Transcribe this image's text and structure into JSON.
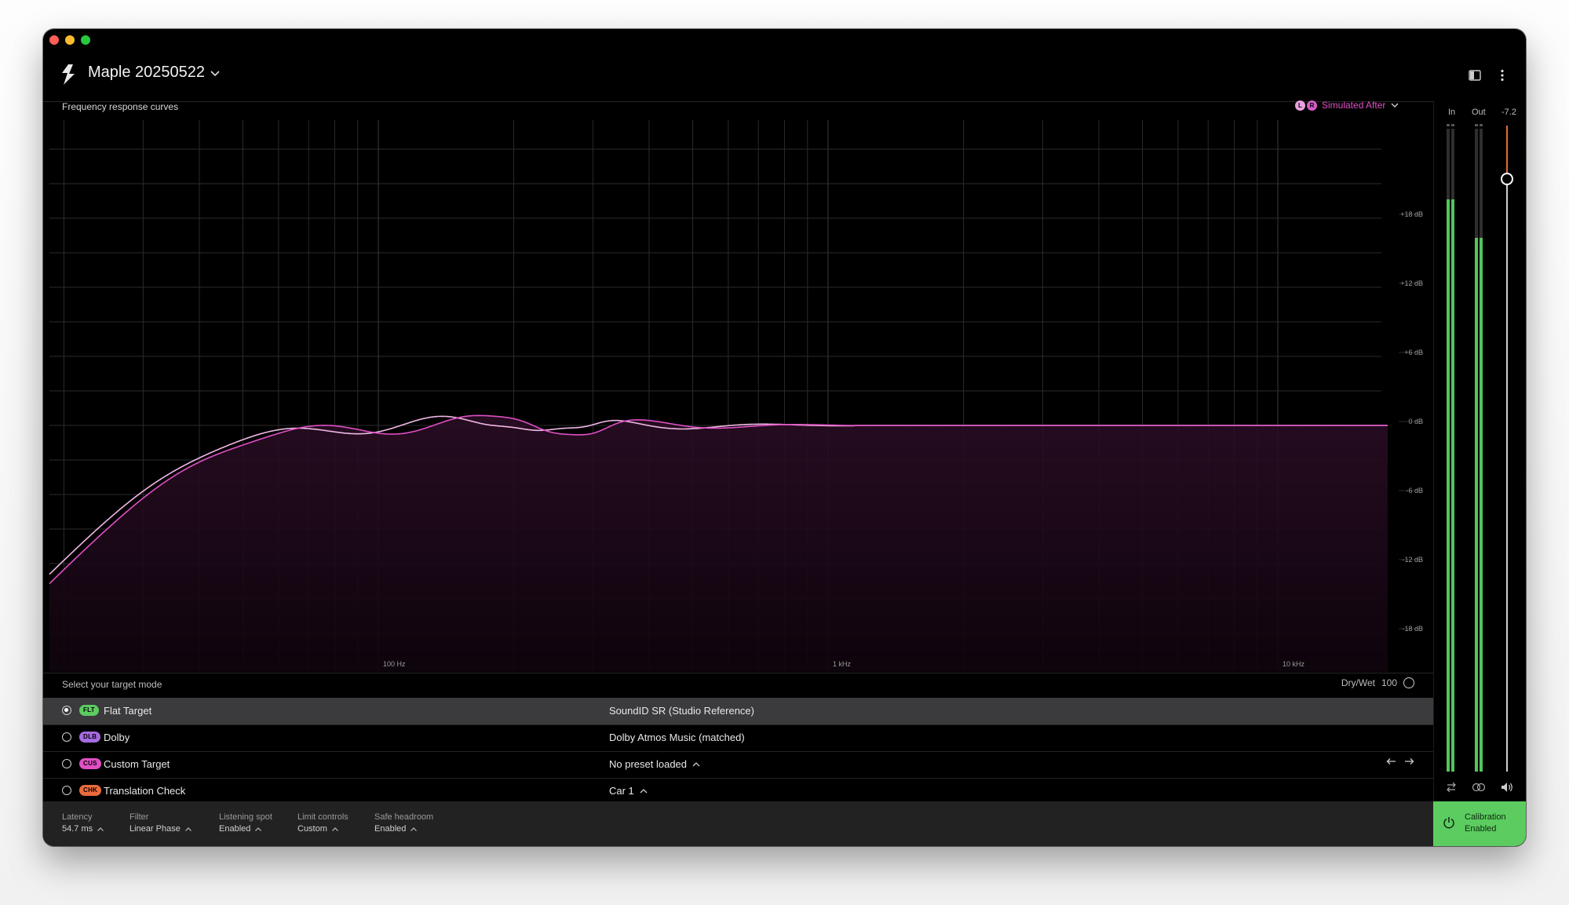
{
  "window": {
    "session_title": "Maple 20250522"
  },
  "graph": {
    "title": "Frequency response curves",
    "view_mode": "Simulated After",
    "channel_left": "L",
    "channel_right": "R",
    "db_labels": [
      "+18 dB",
      "+12 dB",
      "+6 dB",
      "0 dB",
      "-6 dB",
      "-12 dB",
      "-18 dB"
    ],
    "freq_labels": [
      "100 Hz",
      "1 kHz",
      "10 kHz"
    ],
    "curve_color": "#e04fc4",
    "curve_color_alt": "#f0b8e6"
  },
  "meters": {
    "in_label": "In",
    "out_label": "Out",
    "volume_value": "-7.2",
    "in_level": 0.89,
    "out_level": 0.83,
    "meter_color": "#52c65a"
  },
  "target": {
    "prompt": "Select your target mode",
    "drywet_label": "Dry/Wet",
    "drywet_value": "100",
    "modes": [
      {
        "badge": "FLT",
        "badge_color": "#5ccc60",
        "name": "Flat Target",
        "preset": "SoundID SR (Studio Reference)",
        "selected": true
      },
      {
        "badge": "DLB",
        "badge_color": "#a56be0",
        "name": "Dolby",
        "preset": "Dolby Atmos Music (matched)",
        "selected": false
      },
      {
        "badge": "CUS",
        "badge_color": "#e04fc4",
        "name": "Custom Target",
        "preset": "No preset loaded",
        "selected": false
      },
      {
        "badge": "CHK",
        "badge_color": "#ec6a3c",
        "name": "Translation Check",
        "preset": "Car 1",
        "selected": false
      }
    ]
  },
  "status": {
    "latency_label": "Latency",
    "latency_value": "54.7 ms",
    "filter_label": "Filter",
    "filter_value": "Linear Phase",
    "spot_label": "Listening spot",
    "spot_value": "Enabled",
    "limit_label": "Limit controls",
    "limit_value": "Custom",
    "headroom_label": "Safe headroom",
    "headroom_value": "Enabled",
    "calibration_line1": "Calibration",
    "calibration_line2": "Enabled"
  }
}
